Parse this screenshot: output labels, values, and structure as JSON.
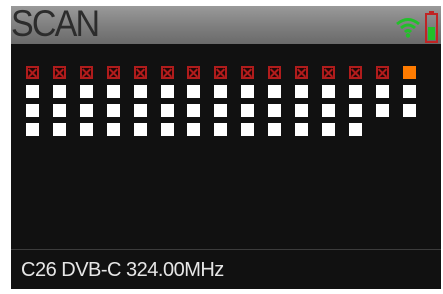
{
  "header": {
    "title": "SCAN",
    "icons": {
      "signal": "wifi-signal-icon",
      "battery": "battery-low-icon"
    },
    "colors": {
      "signal": "#22c02a",
      "battery_frame": "#c02424",
      "battery_fill": "#22c02a"
    }
  },
  "channel_grid": {
    "rows": [
      [
        "failed",
        "failed",
        "failed",
        "failed",
        "failed",
        "failed",
        "failed",
        "failed",
        "failed",
        "failed",
        "failed",
        "failed",
        "failed",
        "failed",
        "current"
      ],
      [
        "locked",
        "locked",
        "locked",
        "locked",
        "locked",
        "locked",
        "locked",
        "locked",
        "locked",
        "locked",
        "locked",
        "locked",
        "locked",
        "locked",
        "locked"
      ],
      [
        "locked",
        "locked",
        "locked",
        "locked",
        "locked",
        "locked",
        "locked",
        "locked",
        "locked",
        "locked",
        "locked",
        "locked",
        "locked",
        "locked",
        "locked"
      ],
      [
        "locked",
        "locked",
        "locked",
        "locked",
        "locked",
        "locked",
        "locked",
        "locked",
        "locked",
        "locked",
        "locked",
        "locked",
        "locked"
      ]
    ],
    "colors": {
      "locked": "#ffffff",
      "failed": "#b01c1c",
      "current": "#ff7b00"
    }
  },
  "status": {
    "text": "C26 DVB-C 324.00MHz"
  }
}
